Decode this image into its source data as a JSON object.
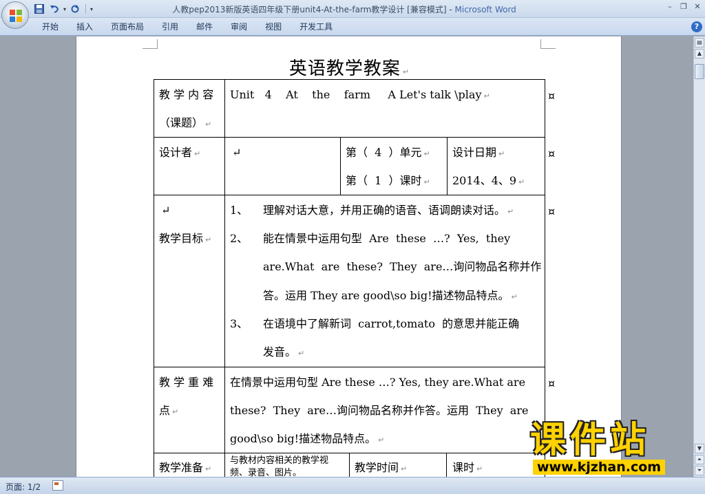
{
  "window": {
    "title": "人教pep2013新版英语四年级下册unit4-At-the-farm教学设计 [兼容模式]",
    "app_name": "Microsoft Word",
    "title_separator": " - ",
    "minimize": "–",
    "restore": "❐",
    "close": "✕"
  },
  "quick_access": {
    "save_icon": "save-icon",
    "undo_icon": "undo-icon",
    "redo_icon": "redo-icon"
  },
  "ribbon": {
    "tabs": [
      "开始",
      "插入",
      "页面布局",
      "引用",
      "邮件",
      "审阅",
      "视图",
      "开发工具"
    ],
    "help": "?"
  },
  "document": {
    "title": "英语教学教案",
    "paragraph_mark": "↵",
    "cell_mark": "¤",
    "rows": {
      "topic_label_1": "教 学 内 容",
      "topic_label_2": "（课题）",
      "topic_value": "Unit   4    At    the    farm     A Let's talk \\play",
      "designer_label": "设计者",
      "unit_label": "第（  4  ）单元",
      "lesson_label": "第（  1  ）课时",
      "date_label": "设计日期",
      "date_value": "2014、4、9",
      "goals_label": "教学目标",
      "goal1_num": "1、",
      "goal1": "理解对话大意，并用正确的语音、语调朗读对话。",
      "goal2_num": "2、",
      "goal2_a": "能在情景中运用句型  Are  these  …?  Yes,  they",
      "goal2_b": "are.What  are  these?  They  are…询问物品名称并作",
      "goal2_c": "答。运用 They are good\\so big!描述物品特点。",
      "goal3_num": "3、",
      "goal3_a": "在语境中了解新词  carrot,tomato  的意思并能正确",
      "goal3_b": "发音。",
      "key_label_1": "教 学 重 难",
      "key_label_2": "点",
      "key_a": "在情景中运用句型 Are these …? Yes, they are.What are",
      "key_b": "these?  They  are…询问物品名称并作答。运用  They  are",
      "key_c": "good\\so big!描述物品特点。",
      "prep_label": "教学准备",
      "prep_value": "与教材内容相关的教学视频、录音、图片。",
      "time_label": "教学时间",
      "period_label": "课时"
    }
  },
  "statusbar": {
    "page": "页面: 1/2"
  },
  "watermark": {
    "big": "课件站",
    "url": "www.kjzhan.com"
  }
}
